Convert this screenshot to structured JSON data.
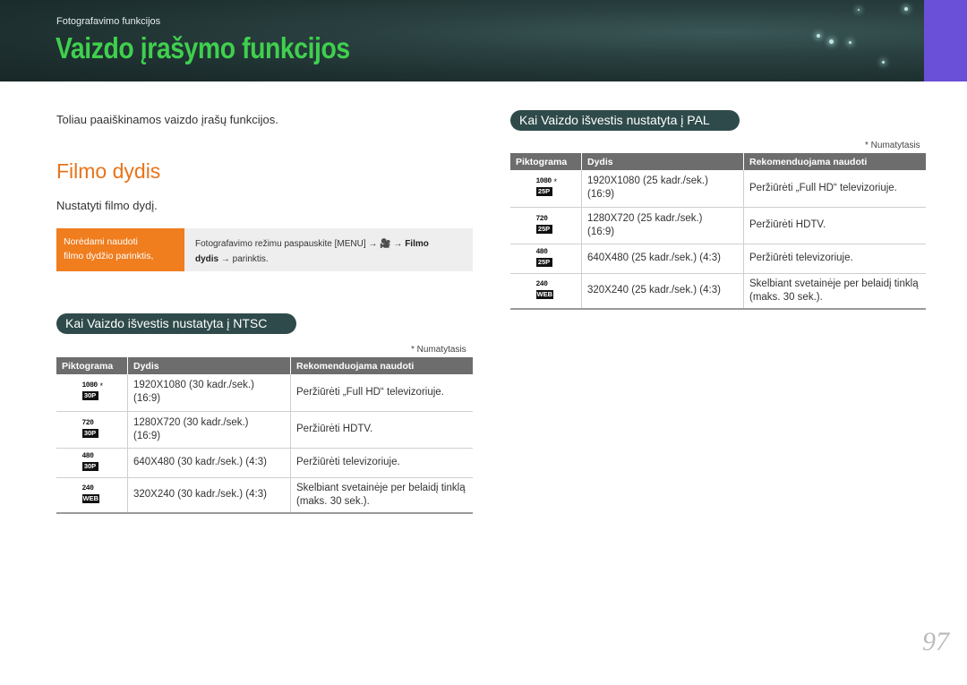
{
  "header": {
    "breadcrumb": "Fotografavimo funkcijos",
    "title": "Vaizdo įrašymo funkcijos"
  },
  "intro": "Toliau paaiškinamos vaizdo įrašų funkcijos.",
  "section_title": "Filmo dydis",
  "set_text": "Nustatyti filmo dydį.",
  "howto": {
    "label_line1": "Norėdami naudoti",
    "label_line2": "filmo dydžio parinktis,",
    "text_part1": "Fotografavimo režimu paspauskite [MENU] → ",
    "camera_glyph": "🎥",
    "text_part2": " → ",
    "filmo": "Filmo",
    "dydis": "dydis",
    "text_part3": " → parinktis."
  },
  "ntsc": {
    "heading": "Kai Vaizdo išvestis nustatyta į NTSC",
    "note": "* Numatytasis",
    "columns": [
      "Piktograma",
      "Dydis",
      "Rekomenduojama naudoti"
    ],
    "rows": [
      {
        "icon_top": "1080",
        "icon_bot": "30P",
        "star": "*",
        "size_l1": "1920X1080 (30 kadr./sek.)",
        "size_l2": "(16:9)",
        "use": "Peržiūrėti „Full HD“ televizoriuje."
      },
      {
        "icon_top": "720",
        "icon_bot": "30P",
        "star": "",
        "size_l1": "1280X720 (30 kadr./sek.)",
        "size_l2": "(16:9)",
        "use": "Peržiūrėti HDTV."
      },
      {
        "icon_top": "480",
        "icon_bot": "30P",
        "star": "",
        "size_l1": "640X480 (30 kadr./sek.) (4:3)",
        "size_l2": "",
        "use": "Peržiūrėti televizoriuje."
      },
      {
        "icon_top": "240",
        "icon_bot": "WEB",
        "star": "",
        "size_l1": "320X240 (30 kadr./sek.) (4:3)",
        "size_l2": "",
        "use": "Skelbiant svetainėje per belaidį tinklą (maks. 30 sek.)."
      }
    ]
  },
  "pal": {
    "heading": "Kai Vaizdo išvestis nustatyta į PAL",
    "note": "* Numatytasis",
    "columns": [
      "Piktograma",
      "Dydis",
      "Rekomenduojama naudoti"
    ],
    "rows": [
      {
        "icon_top": "1080",
        "icon_bot": "25P",
        "star": "*",
        "size_l1": "1920X1080 (25 kadr./sek.)",
        "size_l2": "(16:9)",
        "use": "Peržiūrėti „Full HD“ televizoriuje."
      },
      {
        "icon_top": "720",
        "icon_bot": "25P",
        "star": "",
        "size_l1": "1280X720 (25 kadr./sek.)",
        "size_l2": "(16:9)",
        "use": "Peržiūrėti HDTV."
      },
      {
        "icon_top": "480",
        "icon_bot": "25P",
        "star": "",
        "size_l1": "640X480 (25 kadr./sek.) (4:3)",
        "size_l2": "",
        "use": "Peržiūrėti televizoriuje."
      },
      {
        "icon_top": "240",
        "icon_bot": "WEB",
        "star": "",
        "size_l1": "320X240 (25 kadr./sek.) (4:3)",
        "size_l2": "",
        "use": "Skelbiant svetainėje per belaidį tinklą (maks. 30 sek.)."
      }
    ]
  },
  "page_number": "97",
  "colors": {
    "title_green": "#3fd04d",
    "section_orange": "#e8741a",
    "accent_purple": "#6a4fd8",
    "pill_bg": "#2f4a4a"
  }
}
